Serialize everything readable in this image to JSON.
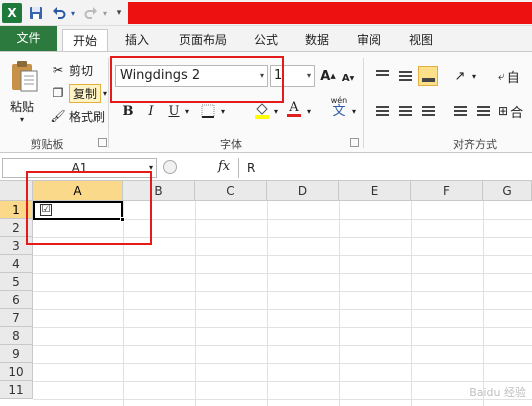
{
  "qat": {
    "logo": "X",
    "save_icon": "save-icon",
    "undo_icon": "undo-icon",
    "redo_icon": "redo-icon"
  },
  "tabs": [
    {
      "label": "文件"
    },
    {
      "label": "开始"
    },
    {
      "label": "插入"
    },
    {
      "label": "页面布局"
    },
    {
      "label": "公式"
    },
    {
      "label": "数据"
    },
    {
      "label": "审阅"
    },
    {
      "label": "视图"
    }
  ],
  "clipboard": {
    "paste_label": "粘贴",
    "cut_label": "剪切",
    "copy_label": "复制",
    "format_painter_label": "格式刷",
    "group_label": "剪贴板"
  },
  "font": {
    "name": "Wingdings 2",
    "size": "1",
    "grow_label": "A",
    "shrink_label": "A",
    "bold_label": "B",
    "italic_label": "I",
    "underline_label": "U",
    "font_color_label": "A",
    "phonetic_label": "wén",
    "phonetic_char": "文",
    "group_label": "字体"
  },
  "alignment": {
    "group_label": "对齐方式",
    "wrap_label": "自",
    "merge_label": "合"
  },
  "formula_bar": {
    "name_box": "A1",
    "fx": "fx",
    "content": "R"
  },
  "grid": {
    "columns": [
      "A",
      "B",
      "C",
      "D",
      "E",
      "F",
      "G"
    ],
    "rows": [
      "1",
      "2",
      "3",
      "4",
      "5",
      "6",
      "7",
      "8",
      "9",
      "10",
      "11"
    ],
    "cell_a1": "☑"
  },
  "watermark": "Baidu 经验"
}
